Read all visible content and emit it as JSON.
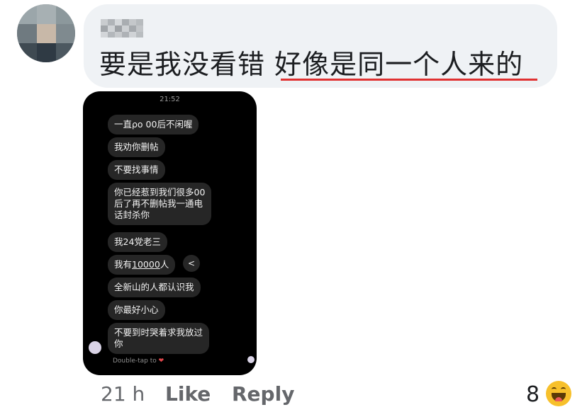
{
  "comment": {
    "text_plain": "要是我没看错 ",
    "text_underlined": "好像是同一个人来的",
    "underline_color": "#e03131"
  },
  "screenshot": {
    "clock": "21:52",
    "messages": [
      "一直ρo 00后不闲喔",
      "我劝你删帖",
      "不要找事情",
      "你已经惹到我们很多00\n后了再不删帖我一通电\n话封杀你",
      "我24党老三",
      "我有",
      "全新山的人都认识我",
      "你最好小心",
      "不要到时哭着求我放过\n你"
    ],
    "message_6_link": "10000",
    "message_6_suffix": "人",
    "share_icon": "share-icon",
    "double_tap_label": "Double-tap to",
    "heart_glyph": "❤"
  },
  "footer": {
    "time": "21 h",
    "like_label": "Like",
    "reply_label": "Reply",
    "reaction_count": "8",
    "reaction_icon": "haha-emoji-icon"
  }
}
